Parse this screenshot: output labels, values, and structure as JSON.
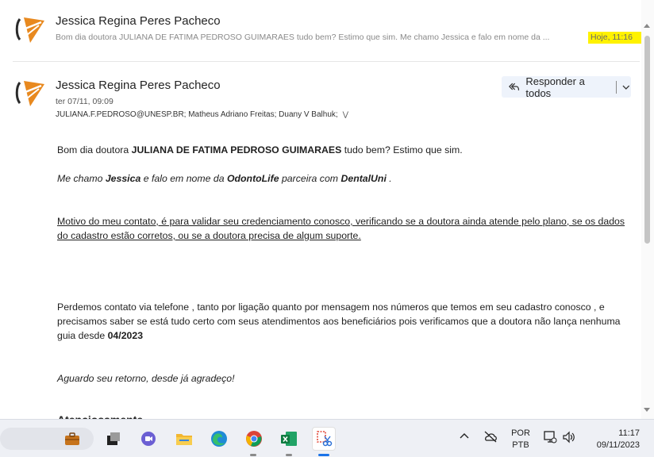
{
  "collapsed_message": {
    "sender": "Jessica Regina Peres Pacheco",
    "preview": "Bom dia doutora JULIANA DE FATIMA PEDROSO GUIMARAES tudo bem? Estimo que sim. Me chamo Jessica e falo em nome da ...",
    "time": "Hoje, 11:16",
    "highlight_color": "#fff200"
  },
  "message": {
    "sender": "Jessica Regina Peres Pacheco",
    "date": "ter 07/11, 09:09",
    "recipients": "JULIANA.F.PEDROSO@UNESP.BR; Matheus Adriano Freitas; Duany V Balhuk;",
    "expand_icon": "double-chevron-down-icon",
    "reply_all_label": "Responder a todos"
  },
  "body": {
    "p1_a": "Bom dia doutora ",
    "p1_b": "JULIANA DE FATIMA PEDROSO GUIMARAES",
    "p1_c": " tudo bem? Estimo que sim.",
    "p2_a": "Me chamo ",
    "p2_b": "Jessica",
    "p2_c": " e falo em nome da ",
    "p2_d": "OdontoLife",
    "p2_e": " parceira com ",
    "p2_f": "DentalUni",
    "p2_g": " .",
    "p3": "Motivo do meu contato, é para validar seu credenciamento conosco, verificando se a doutora ainda atende pelo plano, se os dados do cadastro estão corretos, ou se a doutora precisa de algum suporte.",
    "p4_a": "Perdemos contato via telefone , tanto por ligação quanto por mensagem  nos números que temos em seu cadastro conosco , e precisamos saber se está tudo certo com seus atendimentos aos beneficiários pois verificamos que a doutora não lança nenhuma guia desde ",
    "p4_b": "04/2023",
    "p5": "Aguardo seu retorno, desde já agradeço!",
    "p6_partial": "Atenciosamente"
  },
  "taskbar": {
    "apps": [
      "briefcase-icon",
      "task-view-icon",
      "teams-chat-icon",
      "file-explorer-icon",
      "edge-icon",
      "chrome-icon",
      "excel-icon",
      "snipping-tool-icon"
    ],
    "language_line1": "POR",
    "language_line2": "PTB",
    "time": "11:17",
    "date": "09/11/2023"
  },
  "colors": {
    "accent": "#1a73e8",
    "avatar_orange": "#e8891f",
    "reply_bg": "#eef3fb"
  }
}
